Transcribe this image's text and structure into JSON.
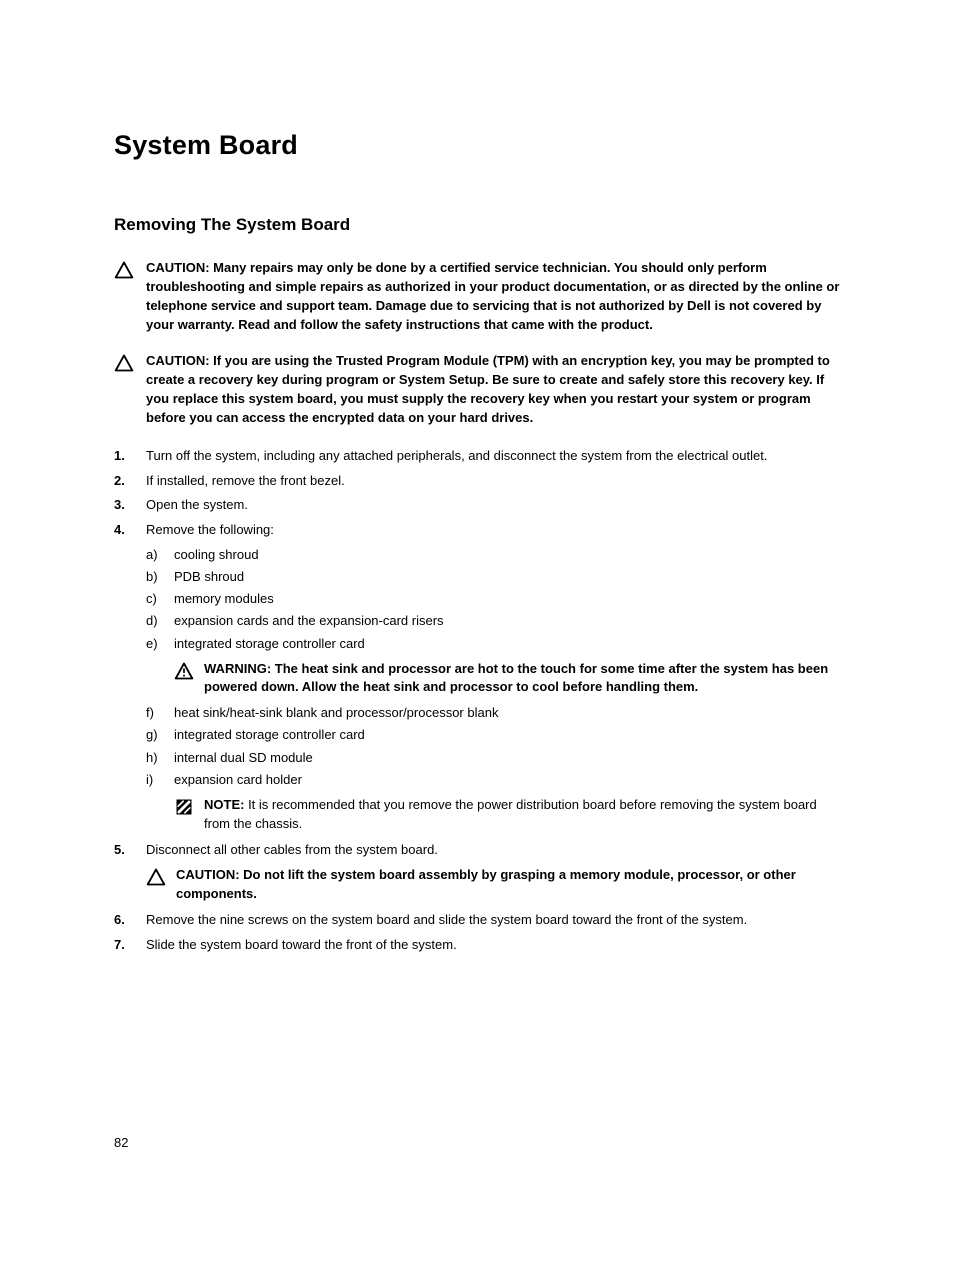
{
  "page_number": "82",
  "title": "System Board",
  "section_heading": "Removing The System Board",
  "caution_lead": "CAUTION: ",
  "warning_lead": "WARNING: ",
  "note_lead": "NOTE: ",
  "caution1": "Many repairs may only be done by a certified service technician. You should only perform troubleshooting and simple repairs as authorized in your product documentation, or as directed by the online or telephone service and support team. Damage due to servicing that is not authorized by Dell is not covered by your warranty. Read and follow the safety instructions that came with the product.",
  "caution2": "If you are using the Trusted Program Module (TPM) with an encryption key, you may be prompted to create a recovery key during program or System Setup. Be sure to create and safely store this recovery key. If you replace this system board, you must supply the recovery key when you restart your system or program before you can access the encrypted data on your hard drives.",
  "steps": {
    "s1": "Turn off the system, including any attached peripherals, and disconnect the system from the electrical outlet.",
    "s2": "If installed, remove the front bezel.",
    "s3": "Open the system.",
    "s4": "Remove the following:",
    "s4_items": {
      "a": "cooling shroud",
      "b": "PDB shroud",
      "c": "memory modules",
      "d": "expansion cards and the expansion-card risers",
      "e": "integrated storage controller card",
      "warning_after_e": "The heat sink and processor are hot to the touch for some time after the system has been powered down. Allow the heat sink and processor to cool before handling them.",
      "f": "heat sink/heat-sink blank and processor/processor blank",
      "g": "integrated storage controller card",
      "h": "internal dual SD module",
      "i": "expansion card holder",
      "note_after_i": "It is recommended that you remove the power distribution board before removing the system board from the chassis."
    },
    "s5": "Disconnect all other cables from the system board.",
    "caution_after_5": "Do not lift the system board assembly by grasping a memory module, processor, or other components.",
    "s6": "Remove the nine screws on the system board and slide the system board toward the front of the system.",
    "s7": "Slide the system board toward the front of the system."
  }
}
